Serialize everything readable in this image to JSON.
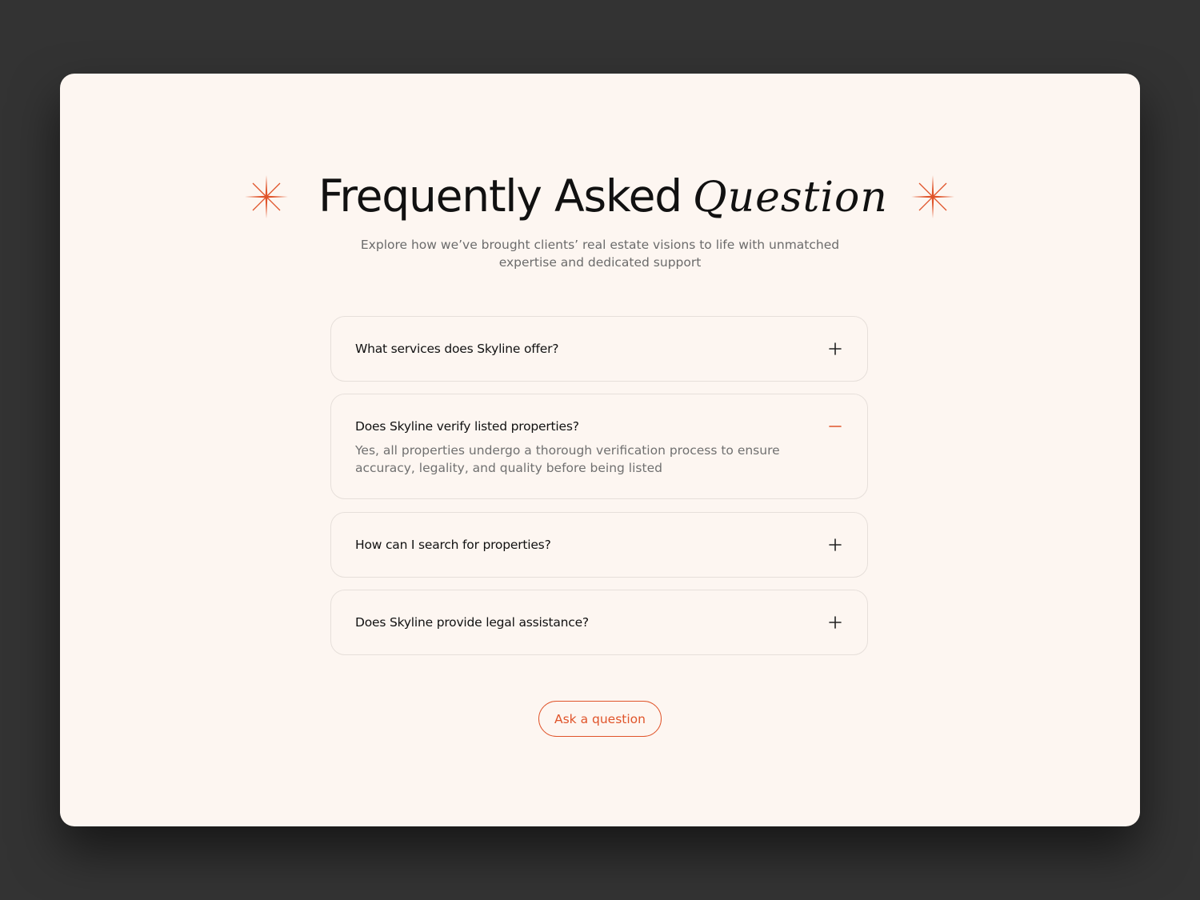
{
  "header": {
    "title_plain": "Frequently Asked",
    "title_fancy": "Question",
    "subtitle": "Explore how we’ve brought clients’ real estate visions to life with unmatched expertise and dedicated support"
  },
  "faq": {
    "items": [
      {
        "question": "What services does Skyline offer?",
        "answer": "",
        "expanded": false,
        "icon": "plus-icon"
      },
      {
        "question": "Does Skyline verify listed properties?",
        "answer": "Yes, all properties undergo a thorough verification process to ensure accuracy, legality, and quality before being listed",
        "expanded": true,
        "icon": "minus-icon"
      },
      {
        "question": "How can I search for properties?",
        "answer": "",
        "expanded": false,
        "icon": "plus-icon"
      },
      {
        "question": "Does Skyline provide legal assistance?",
        "answer": "",
        "expanded": false,
        "icon": "plus-icon"
      }
    ]
  },
  "cta": {
    "ask_label": "Ask a question"
  },
  "colors": {
    "page_background": "#333333",
    "card_background": "#fdf6f1",
    "accent": "#e0542a",
    "text_primary": "#111111",
    "text_secondary": "#6b6b6b",
    "border": "#e6dfda"
  }
}
